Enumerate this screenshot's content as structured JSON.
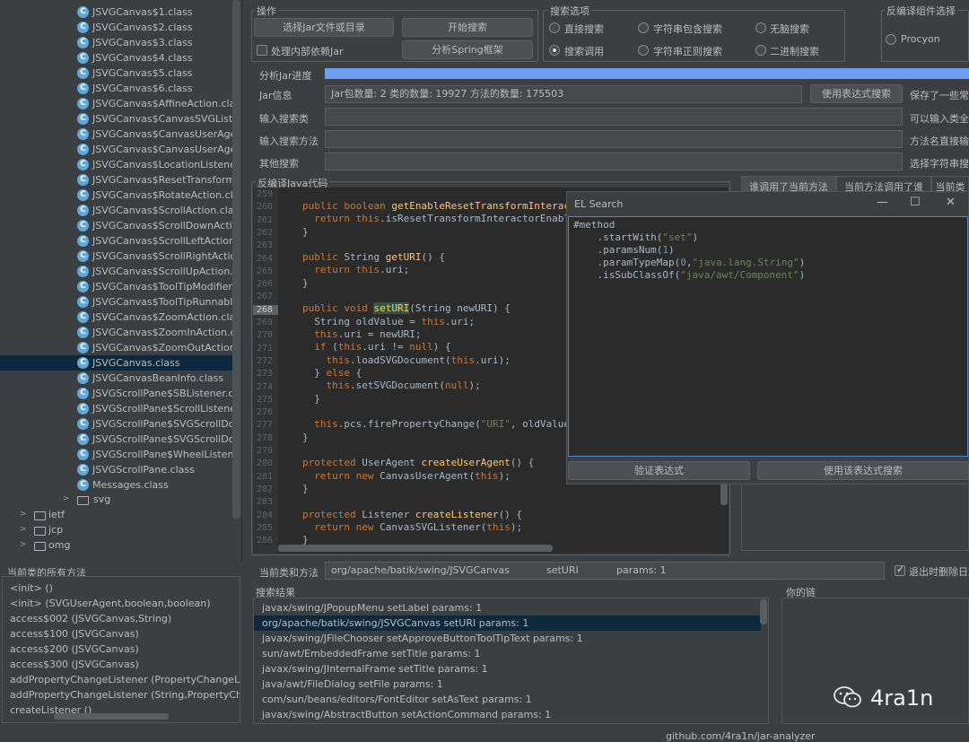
{
  "tree": {
    "classes": [
      {
        "name": "JSVGCanvas$1.class"
      },
      {
        "name": "JSVGCanvas$2.class"
      },
      {
        "name": "JSVGCanvas$3.class"
      },
      {
        "name": "JSVGCanvas$4.class"
      },
      {
        "name": "JSVGCanvas$5.class"
      },
      {
        "name": "JSVGCanvas$6.class"
      },
      {
        "name": "JSVGCanvas$AffineAction.class"
      },
      {
        "name": "JSVGCanvas$CanvasSVGListen"
      },
      {
        "name": "JSVGCanvas$CanvasUserAgen"
      },
      {
        "name": "JSVGCanvas$CanvasUserAgen"
      },
      {
        "name": "JSVGCanvas$LocationListener."
      },
      {
        "name": "JSVGCanvas$ResetTransformA"
      },
      {
        "name": "JSVGCanvas$RotateAction.class"
      },
      {
        "name": "JSVGCanvas$ScrollAction.class"
      },
      {
        "name": "JSVGCanvas$ScrollDownActio"
      },
      {
        "name": "JSVGCanvas$ScrollLeftAction.c"
      },
      {
        "name": "JSVGCanvas$ScrollRightAction"
      },
      {
        "name": "JSVGCanvas$ScrollUpAction.cl"
      },
      {
        "name": "JSVGCanvas$ToolTipModifier."
      },
      {
        "name": "JSVGCanvas$ToolTipRunnable"
      },
      {
        "name": "JSVGCanvas$ZoomAction.class"
      },
      {
        "name": "JSVGCanvas$ZoomInAction.cla"
      },
      {
        "name": "JSVGCanvas$ZoomOutAction.c"
      },
      {
        "name": "JSVGCanvas.class"
      },
      {
        "name": "JSVGCanvasBeanInfo.class"
      },
      {
        "name": "JSVGScrollPane$SBListener.cla"
      },
      {
        "name": "JSVGScrollPane$ScrollListener."
      },
      {
        "name": "JSVGScrollPane$SVGScrollDoc"
      },
      {
        "name": "JSVGScrollPane$SVGScrollDoc"
      },
      {
        "name": "JSVGScrollPane$WheelListener"
      },
      {
        "name": "JSVGScrollPane.class"
      },
      {
        "name": "Messages.class"
      }
    ],
    "selected_index": 23,
    "packages": [
      {
        "name": "svg"
      },
      {
        "name": "ietf"
      },
      {
        "name": "jcp"
      },
      {
        "name": "omg"
      }
    ]
  },
  "methods_panel": {
    "title": "当前类的所有方法",
    "items": [
      "<init> ()",
      "<init> (SVGUserAgent,boolean,boolean)",
      "access$002 (JSVGCanvas,String)",
      "access$100 (JSVGCanvas)",
      "access$200 (JSVGCanvas)",
      "access$300 (JSVGCanvas)",
      "addPropertyChangeListener (PropertyChangeLi",
      "addPropertyChangeListener (String,PropertyCh",
      "createListener ()"
    ]
  },
  "ops": {
    "title": "操作",
    "select_jar": "选择Jar文件或目录",
    "start_search": "开始搜索",
    "inner_deps": "处理内部依赖Jar",
    "analyze_spring": "分析Spring框架"
  },
  "search_opts": {
    "title": "搜索选项",
    "direct": "直接搜索",
    "str_contains": "字符串包含搜索",
    "brainless": "无脑搜索",
    "call_search": "搜索调用",
    "str_regex": "字符串正则搜索",
    "binary": "二进制搜索"
  },
  "decompiler": {
    "title": "反编译组件选择",
    "procyon": "Procyon"
  },
  "progress": {
    "label": "分析Jar进度",
    "percent": 100
  },
  "jar_info": {
    "label": "Jar信息",
    "value": "Jar包数量: 2    类的数量: 19927    方法的数量: 175503",
    "expr_button": "使用表达式搜索",
    "note": "保存了一些常"
  },
  "fields": {
    "class_label": "输入搜索类",
    "class_note": "可以输入类全",
    "method_label": "输入搜索方法",
    "method_note": "方法名直接输",
    "other_label": "其他搜索",
    "other_note": "选择字符串搜"
  },
  "code": {
    "title": "反编译Java代码",
    "line_numbers": [
      "259",
      "260",
      "261",
      "262",
      "263",
      "264",
      "265",
      "266",
      "267",
      "268",
      "269",
      "270",
      "271",
      "272",
      "273",
      "274",
      "275",
      "276",
      "277",
      "278",
      "279",
      "280",
      "281",
      "282",
      "283",
      "284",
      "285",
      "286"
    ],
    "current_line": "268"
  },
  "tabs": [
    "谁调用了当前方法",
    "当前方法调用了谁",
    "当前类"
  ],
  "el_dialog": {
    "title": "EL Search",
    "minimize": "—",
    "maximize": "☐",
    "close": "✕",
    "verify": "验证表达式",
    "use_search": "使用该表达式搜索"
  },
  "current": {
    "label": "当前类和方法",
    "class": "org/apache/batik/swing/JSVGCanvas",
    "method": "setURI",
    "params": "params: 1",
    "exit_delete": "退出时删除日志"
  },
  "results": {
    "title": "搜索结果",
    "rows": [
      "javax/swing/JPopupMenu  setLabel  params: 1",
      "org/apache/batik/swing/JSVGCanvas  setURI  params: 1",
      "javax/swing/JFileChooser  setApproveButtonToolTipText  params: 1",
      "sun/awt/EmbeddedFrame  setTitle  params: 1",
      "javax/swing/JInternalFrame  setTitle  params: 1",
      "java/awt/FileDialog  setFile  params: 1",
      "com/sun/beans/editors/FontEditor  setAsText  params: 1",
      "javax/swing/AbstractButton  setActionCommand  params: 1"
    ],
    "selected_index": 1
  },
  "chain": {
    "title": "你的链"
  },
  "watermark": {
    "handle": "4ra1n",
    "url": "github.com/4ra1n/jar-analyzer"
  },
  "colors": {
    "background": "#3c3f41",
    "editor": "#2b2b2b",
    "selection": "#0d293e",
    "progress": "#6e9ef0",
    "class_icon": "#5fa8de"
  }
}
